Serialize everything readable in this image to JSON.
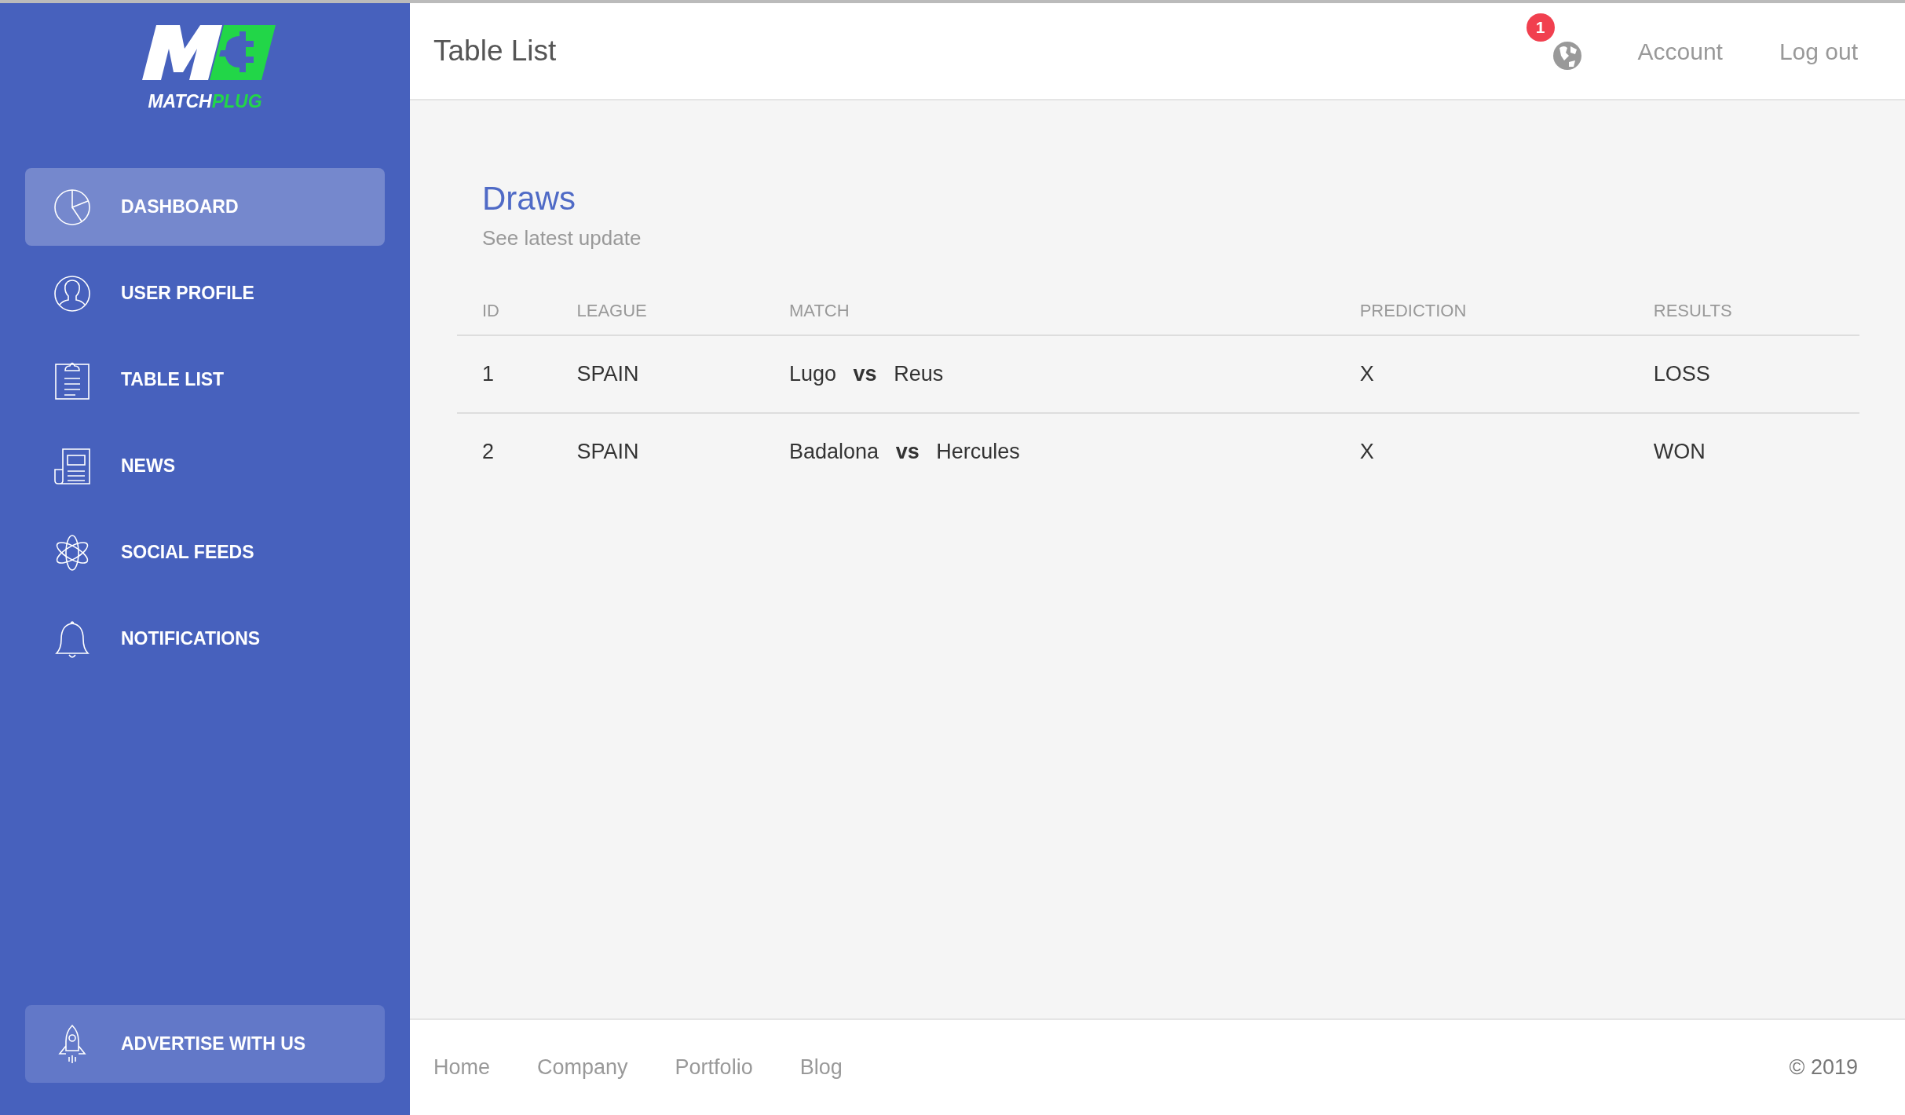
{
  "sidebar": {
    "logo_text": [
      "MATCH",
      "PLUG"
    ],
    "items": [
      {
        "label": "DASHBOARD",
        "selected": true
      },
      {
        "label": "USER PROFILE",
        "selected": false
      },
      {
        "label": "TABLE LIST",
        "selected": false
      },
      {
        "label": "NEWS",
        "selected": false
      },
      {
        "label": "SOCIAL FEEDS",
        "selected": false
      },
      {
        "label": "NOTIFICATIONS",
        "selected": false
      }
    ],
    "bottom_button": {
      "label": "ADVERTISE WITH US"
    }
  },
  "header": {
    "title": "Table List",
    "notification_count": "1",
    "links": [
      "Account",
      "Log out"
    ]
  },
  "card": {
    "title": "Draws",
    "subtitle": "See latest update",
    "table": {
      "columns": [
        "ID",
        "LEAGUE",
        "MATCH",
        "PREDICTION",
        "RESULTS"
      ],
      "rows": [
        [
          "1",
          "SPAIN",
          "Lugo **vs** Reus",
          "X",
          "LOSS"
        ],
        [
          "2",
          "SPAIN",
          "Badalona **vs** Hercules",
          "X",
          "WON"
        ]
      ]
    }
  },
  "footer": {
    "links": [
      "Home",
      "Company",
      "Portfolio",
      "Blog"
    ],
    "copyright": "© 2019"
  }
}
